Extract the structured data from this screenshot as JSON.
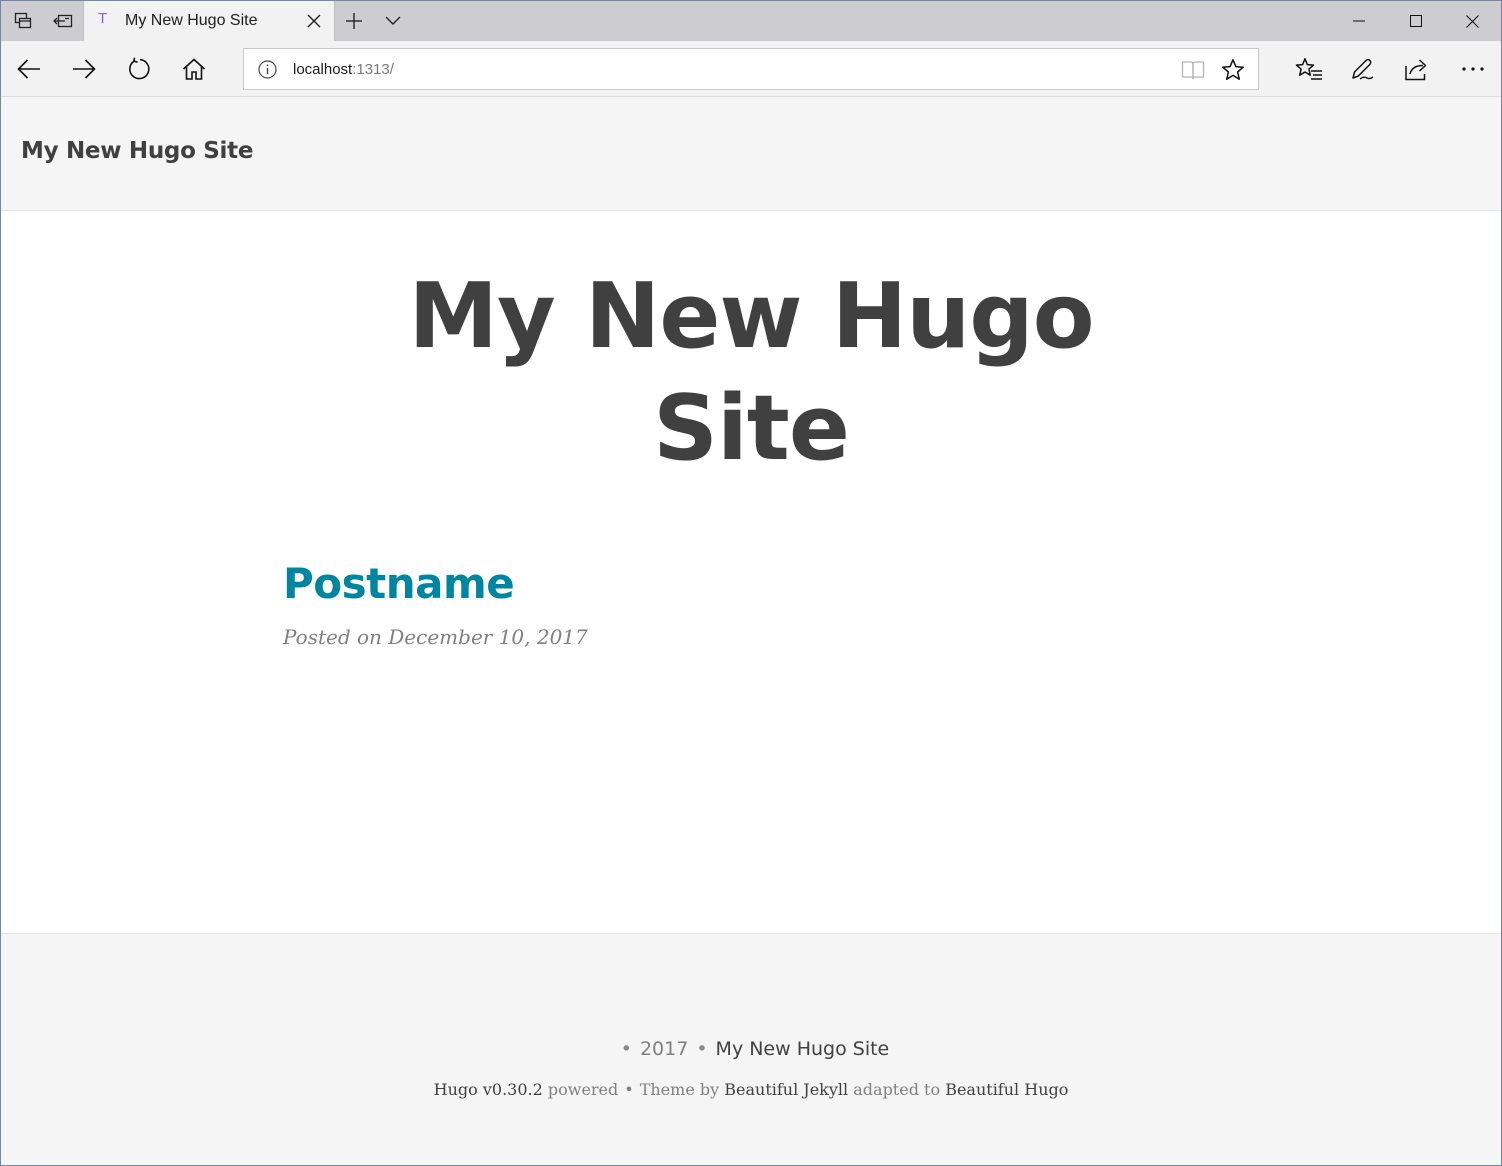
{
  "browser": {
    "tab": {
      "favicon": "T",
      "title": "My New Hugo Site"
    },
    "address": {
      "host": "localhost",
      "port_path": ":1313/"
    },
    "icons": {
      "tab_manager": "tab-manager-icon",
      "set_aside": "set-aside-tabs-icon",
      "new_tab": "plus-icon",
      "tab_list": "chevron-down-icon",
      "minimize": "minimize-icon",
      "maximize": "maximize-icon",
      "close": "close-icon",
      "back": "back-arrow-icon",
      "forward": "forward-arrow-icon",
      "refresh": "refresh-icon",
      "home": "home-icon",
      "info": "info-icon",
      "reading_view": "book-icon",
      "favorite": "star-icon",
      "favorites_hub": "favorites-list-icon",
      "notes": "pen-icon",
      "share": "share-icon",
      "more": "more-icon"
    }
  },
  "site": {
    "brand": "My New Hugo Site",
    "hero_title": "My New Hugo Site",
    "post": {
      "title": "Postname",
      "meta": "Posted on December 10, 2017"
    },
    "footer": {
      "year": "2017",
      "site_link": "My New Hugo Site",
      "hugo_link": "Hugo v0.30.2",
      "powered": " powered",
      "theme_by": "Theme by ",
      "jekyll_link": "Beautiful Jekyll",
      "adapted": " adapted to ",
      "hugo_theme_link": "Beautiful Hugo",
      "separator": "•"
    },
    "colors": {
      "link": "#0085a1",
      "text": "#404040",
      "muted": "#808080",
      "band": "#f5f5f5"
    }
  }
}
